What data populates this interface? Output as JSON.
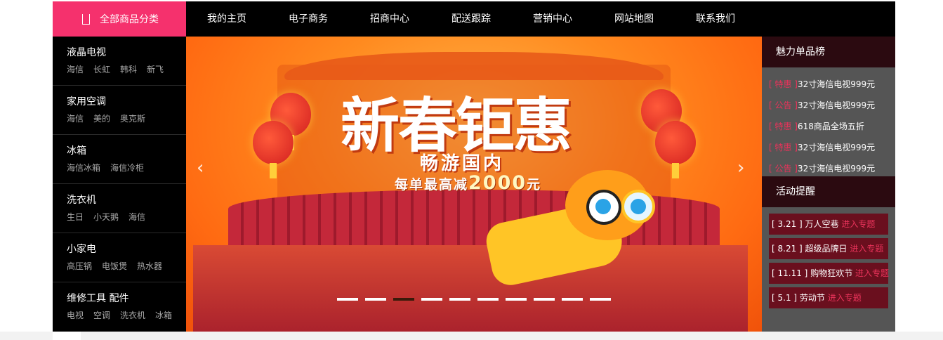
{
  "category_button": {
    "label": "全部商品分类",
    "icon": "list-icon"
  },
  "nav": [
    "我的主页",
    "电子商务",
    "招商中心",
    "配送跟踪",
    "营销中心",
    "网站地图",
    "联系我们"
  ],
  "categories": [
    {
      "title": "液晶电视",
      "subs": [
        "海信",
        "长虹",
        "韩科",
        "新飞"
      ]
    },
    {
      "title": "家用空调",
      "subs": [
        "海信",
        "美的",
        "奥克斯"
      ]
    },
    {
      "title": "冰箱",
      "subs": [
        "海信冰箱",
        "海信冷柜"
      ]
    },
    {
      "title": "洗衣机",
      "subs": [
        "生日",
        "小天鹅",
        "海信"
      ]
    },
    {
      "title": "小家电",
      "subs": [
        "高压锅",
        "电饭煲",
        "热水器"
      ]
    },
    {
      "title": "维修工具 配件",
      "subs": [
        "电视",
        "空调",
        "洗衣机",
        "冰箱"
      ]
    }
  ],
  "banner": {
    "headline": "新春钜惠",
    "sub1": "畅游国内",
    "sub2_prefix": "每单最高减",
    "sub2_amount": "2000",
    "sub2_unit": "元",
    "prev": "‹",
    "next": "›",
    "slide_count": 10,
    "active_slide": 3
  },
  "ranking": {
    "title": "魅力单品榜",
    "items": [
      {
        "tag": "[ 特惠 ]",
        "text": "32寸海信电视999元"
      },
      {
        "tag": "[ 公告 ]",
        "text": "32寸海信电视999元"
      },
      {
        "tag": "[ 特惠 ]",
        "text": "618商品全场五折"
      },
      {
        "tag": "[ 特惠 ]",
        "text": "32寸海信电视999元"
      },
      {
        "tag": "[ 公告 ]",
        "text": "32寸海信电视999元"
      }
    ]
  },
  "events": {
    "title": "活动提醒",
    "items": [
      {
        "date": "[ 3.21 ]",
        "name": "万人空巷",
        "link": "进入专题"
      },
      {
        "date": "[ 8.21 ]",
        "name": "超级品牌日",
        "link": "进入专题"
      },
      {
        "date": "[ 11.11 ]",
        "name": "购物狂欢节",
        "link": "进入专题"
      },
      {
        "date": "[ 5.1 ]",
        "name": "劳动节",
        "link": "进入专题"
      }
    ]
  },
  "colors": {
    "accent": "#f5316d",
    "nav_bg": "#000000",
    "panel_head": "#2b0a10",
    "event_bg": "#6a0f1e",
    "tag": "#e8335a"
  }
}
